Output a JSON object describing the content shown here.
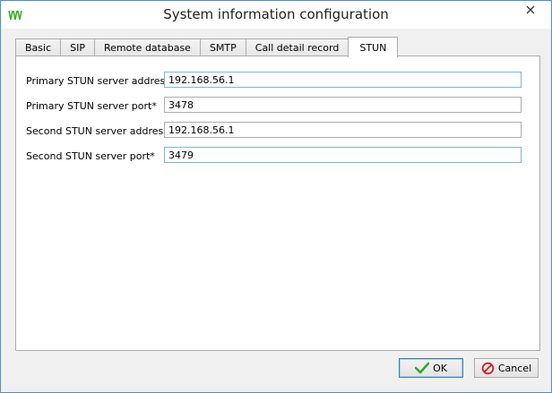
{
  "window": {
    "title": "System information configuration"
  },
  "tabs": [
    {
      "label": "Basic",
      "active": false
    },
    {
      "label": "SIP",
      "active": false
    },
    {
      "label": "Remote database",
      "active": false
    },
    {
      "label": "SMTP",
      "active": false
    },
    {
      "label": "Call detail record",
      "active": false
    },
    {
      "label": "STUN",
      "active": true
    }
  ],
  "form": {
    "primary_address": {
      "label": "Primary STUN server address*",
      "value": "192.168.56.1"
    },
    "primary_port": {
      "label": "Primary STUN server port*",
      "value": "3478"
    },
    "second_address": {
      "label": "Second STUN server address*",
      "value": "192.168.56.1"
    },
    "second_port": {
      "label": "Second STUN server port*",
      "value": "3479"
    }
  },
  "buttons": {
    "ok": "OK",
    "cancel": "Cancel"
  },
  "colors": {
    "accent": "#4b8fd0",
    "ok_check": "#3aa335",
    "cancel_icon": "#c62828",
    "app_icon": "#3dae2b"
  }
}
